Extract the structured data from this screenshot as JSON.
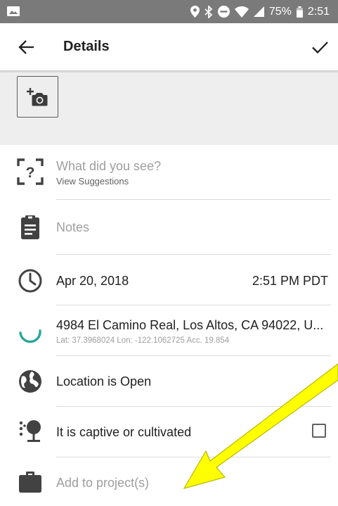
{
  "status_bar": {
    "battery": "75%",
    "time": "2:51"
  },
  "toolbar": {
    "title": "Details"
  },
  "species": {
    "placeholder": "What did you see?",
    "suggestions": "View Suggestions"
  },
  "notes": {
    "placeholder": "Notes"
  },
  "datetime": {
    "date": "Apr 20, 2018",
    "time": "2:51 PM PDT"
  },
  "location": {
    "address": "4984 El Camino Real, Los Altos, CA 94022, U...",
    "details": "Lat: 37.3968024 Lon: -122.1062725 Acc. 19.854"
  },
  "geoprivacy": {
    "label": "Location is Open"
  },
  "captive": {
    "label": "It is captive or cultivated",
    "checked": false
  },
  "projects": {
    "placeholder": "Add to project(s)"
  },
  "colors": {
    "status_bar": "#7a7a7a",
    "photo_area": "#eeeeee",
    "accent": "#26a69a",
    "annotation_arrow": "#ffff00"
  }
}
